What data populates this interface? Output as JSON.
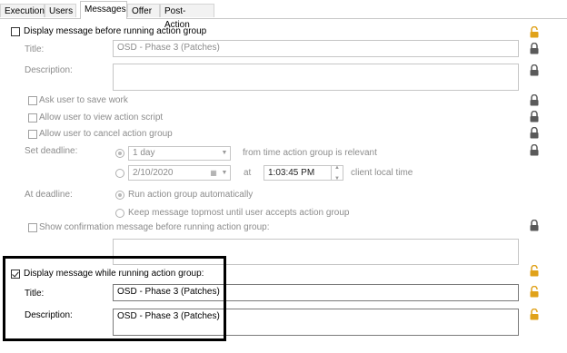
{
  "tabs": [
    {
      "label": "Execution"
    },
    {
      "label": "Users"
    },
    {
      "label": "Messages"
    },
    {
      "label": "Offer"
    },
    {
      "label": "Post-Action"
    }
  ],
  "before": {
    "checkbox_label": "Display message before running action group",
    "title_label": "Title:",
    "title_value": "OSD - Phase 3 (Patches)",
    "description_label": "Description:",
    "description_value": "",
    "ask_save": "Ask user to save work",
    "allow_view": "Allow user to view action script",
    "allow_cancel": "Allow user to cancel action group",
    "set_deadline_label": "Set deadline:",
    "deadline_duration": "1 day",
    "deadline_relevant_text": "from time action group is relevant",
    "deadline_date": "2/10/2020",
    "at_label": "at",
    "deadline_time": "1:03:45 PM",
    "client_time_text": "client local time",
    "at_deadline_label": "At deadline:",
    "run_auto": "Run action group automatically",
    "keep_topmost": "Keep message topmost until user accepts action group",
    "show_confirm": "Show confirmation message before running action group:",
    "confirm_value": ""
  },
  "while": {
    "checkbox_label": "Display message while running action group:",
    "checked": true,
    "title_label": "Title:",
    "title_value": "OSD - Phase 3 (Patches)",
    "description_label": "Description:",
    "description_value": "OSD - Phase 3 (Patches)"
  },
  "colors": {
    "lock_locked": "#5a5a5a",
    "lock_open": "#e0a21a",
    "highlight_box": "#000000"
  }
}
